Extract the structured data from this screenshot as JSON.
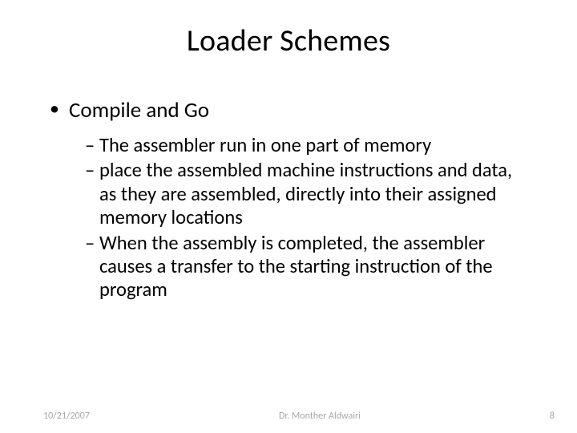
{
  "title": "Loader Schemes",
  "bullet1": "Compile and Go",
  "sub1": "The assembler run in one part of memory",
  "sub2": "place the assembled machine instructions and data, as they are assembled, directly into their assigned memory locations",
  "sub3": "When the assembly is completed, the assembler causes a transfer to the starting instruction of the program",
  "footer": {
    "date": "10/21/2007",
    "author": "Dr. Monther Aldwairi",
    "page": "8"
  }
}
